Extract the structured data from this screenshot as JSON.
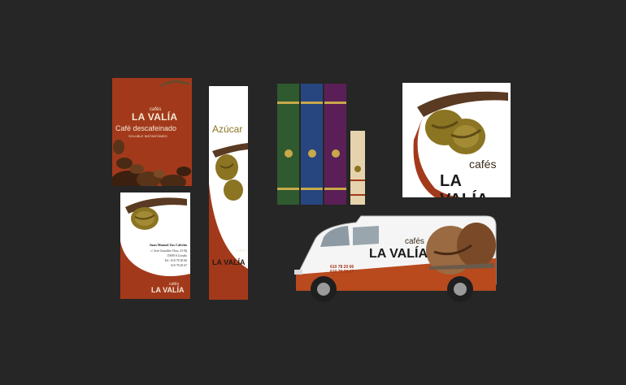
{
  "brand": {
    "cafes": "cafés",
    "name": "LA VALÍA"
  },
  "colors": {
    "rust": "#a3391b",
    "gold": "#8b7422",
    "brown": "#5a3a22",
    "green": "#2f5a2f",
    "blue": "#27457f",
    "purple": "#5a1f56",
    "cream": "#e5d3ad"
  },
  "box": {
    "product": "Café descafeinado",
    "subtitle": "SOLUBLE INSTANTÁNEO"
  },
  "business_card": {
    "person": "Juan Manuel Zas Calviño",
    "address": "c/ José González Chas, 41-Bj",
    "city": "15009 A Coruña",
    "tel": "Tel.: 610 78 20 66",
    "tel2": "610 78 20 67"
  },
  "sugar": {
    "label": "Azúcar"
  },
  "van": {
    "phone1": "610 78 20 66",
    "phone2": "610 78 20 67"
  },
  "icons": [
    "coffee-bean-logo",
    "van-wheel"
  ]
}
